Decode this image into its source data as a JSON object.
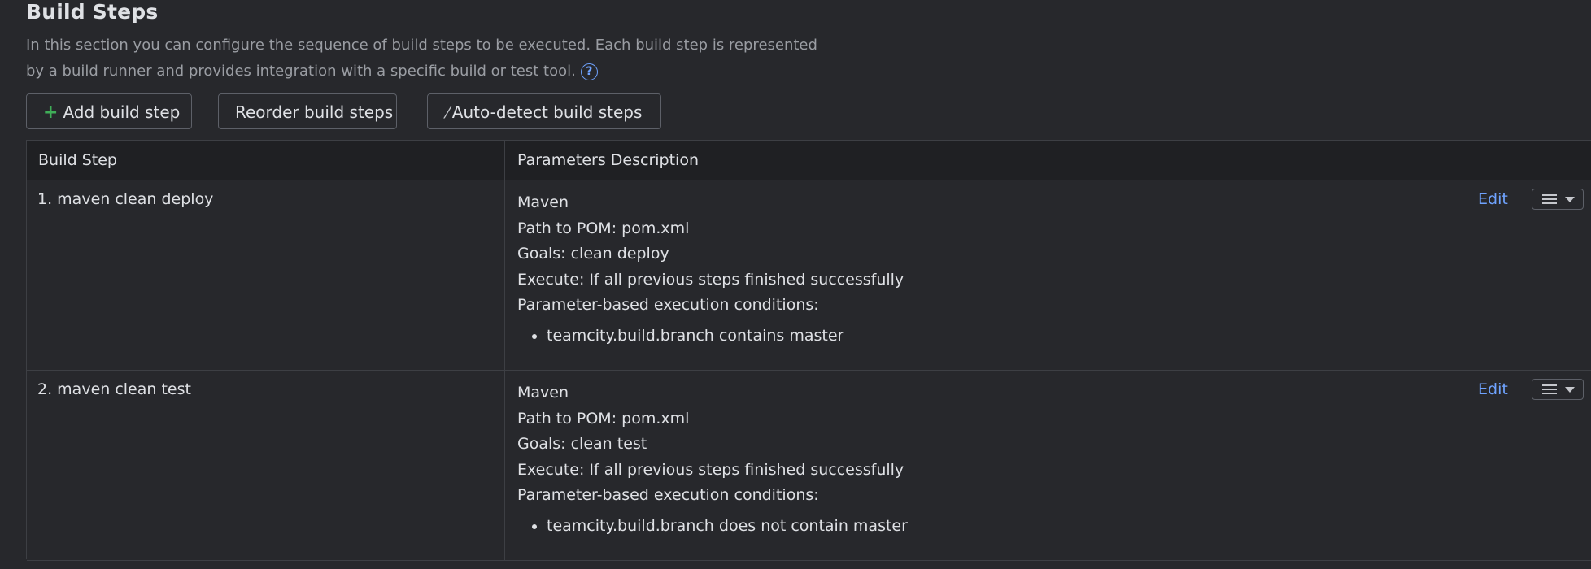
{
  "section": {
    "title": "Build Steps",
    "description": "In this section you can configure the sequence of build steps to be executed. Each build step is represented by a build runner and provides integration with a specific build or test tool."
  },
  "toolbar": {
    "add_label": "Add build step",
    "reorder_label": "Reorder build steps",
    "autodetect_label": "Auto-detect build steps"
  },
  "table": {
    "headers": [
      "Build Step",
      "Parameters Description"
    ],
    "rows": [
      {
        "name": "1. maven clean deploy",
        "runner": "Maven",
        "path": "Path to POM: pom.xml",
        "goals": "Goals: clean deploy",
        "execute": "Execute: If all previous steps finished successfully",
        "conditions_label": "Parameter-based execution conditions:",
        "condition": "teamcity.build.branch contains master",
        "edit_label": "Edit"
      },
      {
        "name": "2. maven clean test",
        "runner": "Maven",
        "path": "Path to POM: pom.xml",
        "goals": "Goals: clean test",
        "execute": "Execute: If all previous steps finished successfully",
        "conditions_label": "Parameter-based execution conditions:",
        "condition": "teamcity.build.branch does not contain master",
        "edit_label": "Edit"
      }
    ]
  },
  "icons": {
    "help": "question-circle-icon",
    "add": "plus-icon",
    "autodetect": "magic-wand-icon",
    "row_menu": "list-icon",
    "row_menu_caret": "caret-down-icon"
  },
  "colors": {
    "background": "#27282c",
    "header_background": "#1f2023",
    "link": "#6fa3ff",
    "add_icon": "#3fae58",
    "muted_text": "#9a9da3"
  }
}
